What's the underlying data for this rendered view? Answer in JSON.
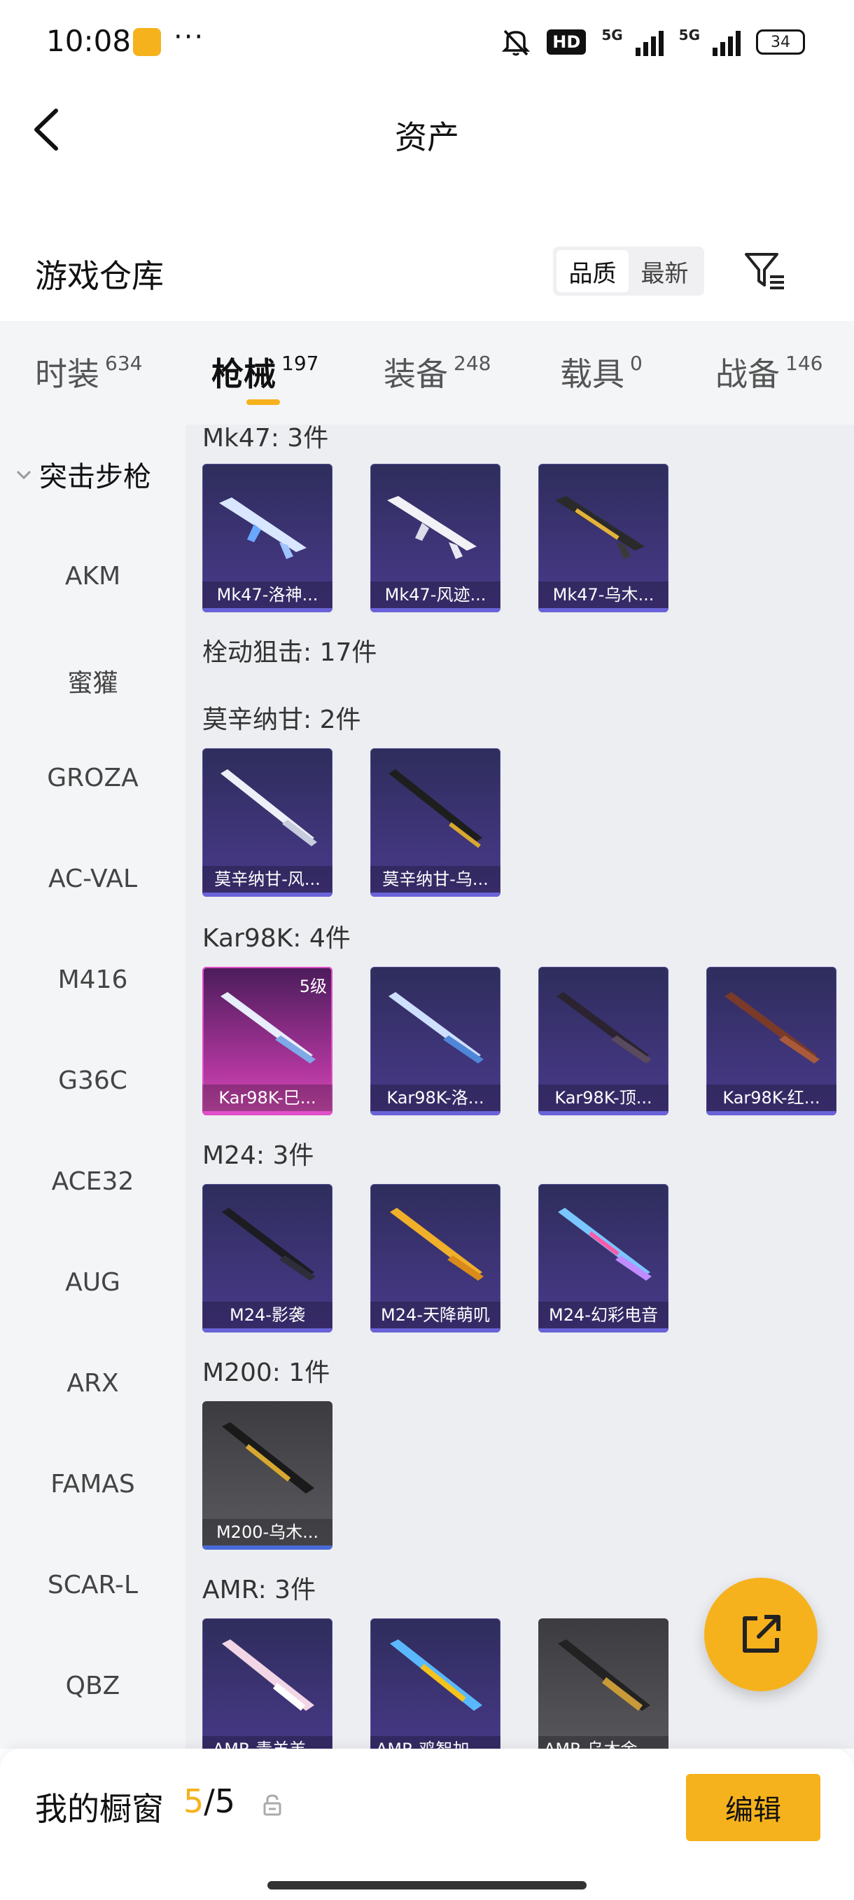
{
  "status_bar": {
    "time": "10:08",
    "dots": "···",
    "hd": "HD",
    "net1": "5G",
    "net2": "5G",
    "battery": "34"
  },
  "nav": {
    "title": "资产"
  },
  "section": {
    "title": "游戏仓库",
    "sort_options": [
      "品质",
      "最新"
    ],
    "sort_active_index": 0
  },
  "tabs": [
    {
      "label": "时装",
      "count": "634"
    },
    {
      "label": "枪械",
      "count": "197"
    },
    {
      "label": "装备",
      "count": "248"
    },
    {
      "label": "载具",
      "count": "0"
    },
    {
      "label": "战备",
      "count": "146"
    }
  ],
  "active_tab_index": 1,
  "sidebar": {
    "group": "突击步枪",
    "items": [
      "AKM",
      "蜜獾",
      "GROZA",
      "AC-VAL",
      "M416",
      "G36C",
      "ACE32",
      "AUG",
      "ARX",
      "FAMAS",
      "SCAR-L",
      "QBZ"
    ]
  },
  "content": {
    "groups": [
      {
        "title": "Mk47: 3件",
        "cards": [
          "Mk47-洛神...",
          "Mk47-风迹...",
          "Mk47-乌木..."
        ]
      },
      {
        "title": "栓动狙击: 17件",
        "cards": []
      },
      {
        "title": "莫辛纳甘: 2件",
        "cards": [
          "莫辛纳甘-风...",
          "莫辛纳甘-乌..."
        ]
      },
      {
        "title": "Kar98K: 4件",
        "cards": [
          "Kar98K-巳...",
          "Kar98K-洛...",
          "Kar98K-顶...",
          "Kar98K-红..."
        ],
        "badge": "5级"
      },
      {
        "title": "M24: 3件",
        "cards": [
          "M24-影袭",
          "M24-天降萌叽",
          "M24-幻彩电音"
        ]
      },
      {
        "title": "M200: 1件",
        "cards": [
          "M200-乌木..."
        ]
      },
      {
        "title": "AMR: 3件",
        "cards": [
          "AMR-青羊羔...",
          "AMR-鸡智加我...",
          "AMR-乌木金纹..."
        ]
      }
    ]
  },
  "bottom": {
    "showcase_label": "我的橱窗",
    "showcase_current": "5",
    "showcase_sep": "/",
    "showcase_total": "5",
    "edit_label": "编辑"
  },
  "colors": {
    "accent": "#f6b21c",
    "card_purple": "#4a3a8c",
    "card_pink": "#d84fb8"
  }
}
